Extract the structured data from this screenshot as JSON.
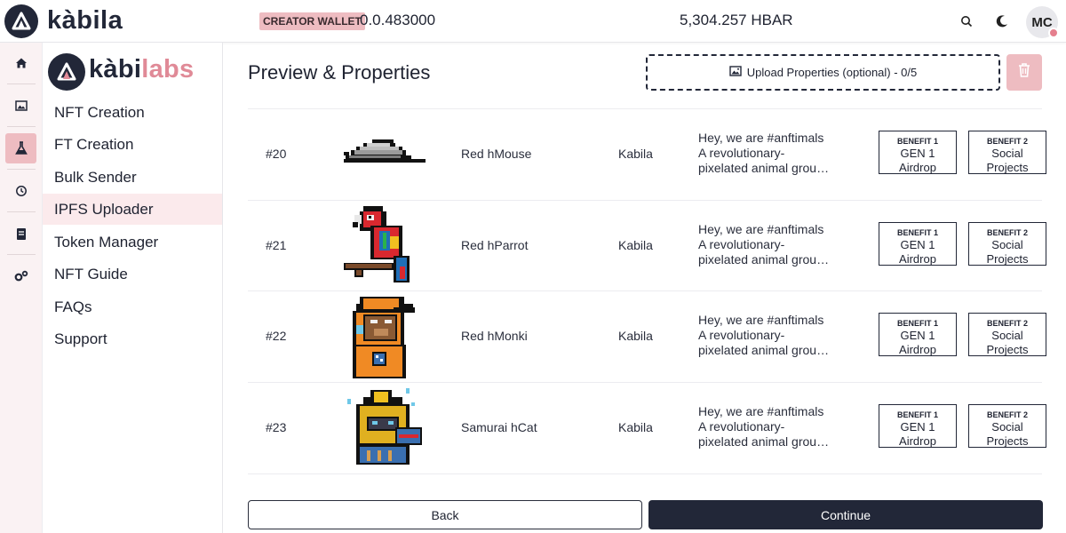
{
  "header": {
    "brand": "kàbila",
    "wallet_badge": "CREATOR WALLET",
    "wallet_id": "0.0.483000",
    "balance": "5,304.257 HBAR",
    "avatar_initials": "MC"
  },
  "rail": {
    "items": [
      "home-icon",
      "image-icon",
      "flask-icon",
      "history-icon",
      "document-icon",
      "settings-icon"
    ],
    "active_index": 2
  },
  "sidebar": {
    "brand_part1": "kàbi",
    "brand_part2": "labs",
    "items": [
      {
        "label": "NFT Creation"
      },
      {
        "label": "FT Creation"
      },
      {
        "label": "Bulk Sender"
      },
      {
        "label": "IPFS Uploader"
      },
      {
        "label": "Token Manager"
      },
      {
        "label": "NFT Guide"
      },
      {
        "label": "FAQs"
      },
      {
        "label": "Support"
      }
    ],
    "active_index": 3
  },
  "main": {
    "title": "Preview & Properties",
    "upload_label": "Upload Properties (optional) - 0/5",
    "rows": [
      {
        "num": "#20",
        "name": "Red hMouse",
        "creator": "Kabila",
        "desc": [
          "Hey, we are #anftimals",
          "A revolutionary-",
          "pixelated animal grou…"
        ],
        "benefits": [
          {
            "title": "BENEFIT 1",
            "line1": "GEN 1",
            "line2": "Airdrop"
          },
          {
            "title": "BENEFIT 2",
            "line1": "Social",
            "line2": "Projects"
          }
        ]
      },
      {
        "num": "#21",
        "name": "Red hParrot",
        "creator": "Kabila",
        "desc": [
          "Hey, we are #anftimals",
          "A revolutionary-",
          "pixelated animal grou…"
        ],
        "benefits": [
          {
            "title": "BENEFIT 1",
            "line1": "GEN 1",
            "line2": "Airdrop"
          },
          {
            "title": "BENEFIT 2",
            "line1": "Social",
            "line2": "Projects"
          }
        ]
      },
      {
        "num": "#22",
        "name": "Red hMonki",
        "creator": "Kabila",
        "desc": [
          "Hey, we are #anftimals",
          "A revolutionary-",
          "pixelated animal grou…"
        ],
        "benefits": [
          {
            "title": "BENEFIT 1",
            "line1": "GEN 1",
            "line2": "Airdrop"
          },
          {
            "title": "BENEFIT 2",
            "line1": "Social",
            "line2": "Projects"
          }
        ]
      },
      {
        "num": "#23",
        "name": "Samurai hCat",
        "creator": "Kabila",
        "desc": [
          "Hey, we are #anftimals",
          "A revolutionary-",
          "pixelated animal grou…"
        ],
        "benefits": [
          {
            "title": "BENEFIT 1",
            "line1": "GEN 1",
            "line2": "Airdrop"
          },
          {
            "title": "BENEFIT 2",
            "line1": "Social",
            "line2": "Projects"
          }
        ]
      }
    ],
    "back_label": "Back",
    "continue_label": "Continue"
  },
  "colors": {
    "dark": "#222738",
    "accent_pink": "#eebcc1",
    "brand_pink": "#e08a97",
    "active_nav": "#fbeaec"
  }
}
